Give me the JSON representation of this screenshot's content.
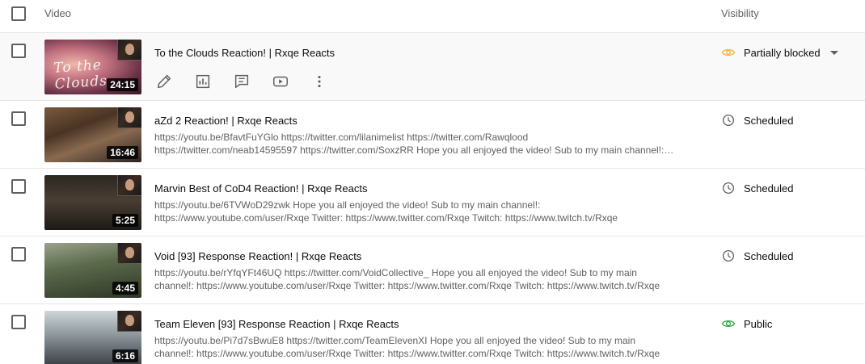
{
  "header": {
    "video_label": "Video",
    "visibility_label": "Visibility"
  },
  "rows": [
    {
      "title": "To the Clouds Reaction! | Rxqe Reacts",
      "duration": "24:15",
      "thumbnail_text": "To the Clouds",
      "description": "",
      "visibility": "Partially blocked",
      "visibility_icon": "eye-icon",
      "visibility_color": "#f2b134"
    },
    {
      "title": "aZd 2 Reaction! | Rxqe Reacts",
      "duration": "16:46",
      "description": "https://youtu.be/BfavtFuYGlo https://twitter.com/lilanimelist https://twitter.com/Rawqlood\nhttps://twitter.com/neab14595597 https://twitter.com/SoxzRR Hope you all enjoyed the video! Sub to my main channel!:…",
      "visibility": "Scheduled",
      "visibility_icon": "clock-icon",
      "visibility_color": "#606060"
    },
    {
      "title": "Marvin Best of CoD4 Reaction! | Rxqe Reacts",
      "duration": "5:25",
      "description": "https://youtu.be/6TVWoD29zwk Hope you all enjoyed the video! Sub to my main channel!:\nhttps://www.youtube.com/user/Rxqe Twitter: https://www.twitter.com/Rxqe Twitch: https://www.twitch.tv/Rxqe",
      "visibility": "Scheduled",
      "visibility_icon": "clock-icon",
      "visibility_color": "#606060"
    },
    {
      "title": "Void [93] Response Reaction! | Rxqe Reacts",
      "duration": "4:45",
      "description": "https://youtu.be/rYfqYFt46UQ https://twitter.com/VoidCollective_ Hope you all enjoyed the video! Sub to my main\nchannel!: https://www.youtube.com/user/Rxqe Twitter: https://www.twitter.com/Rxqe Twitch: https://www.twitch.tv/Rxqe",
      "visibility": "Scheduled",
      "visibility_icon": "clock-icon",
      "visibility_color": "#606060"
    },
    {
      "title": "Team Eleven [93] Response Reaction | Rxqe Reacts",
      "duration": "6:16",
      "description": "https://youtu.be/Pi7d7sBwuE8 https://twitter.com/TeamElevenXI Hope you all enjoyed the video! Sub to my main\nchannel!: https://www.youtube.com/user/Rxqe Twitter: https://www.twitter.com/Rxqe Twitch: https://www.twitch.tv/Rxqe",
      "visibility": "Public",
      "visibility_icon": "eye-icon",
      "visibility_color": "#2ba640"
    }
  ],
  "hover_actions": [
    "pencil-icon",
    "analytics-icon",
    "comments-icon",
    "youtube-icon",
    "more-vert-icon"
  ]
}
